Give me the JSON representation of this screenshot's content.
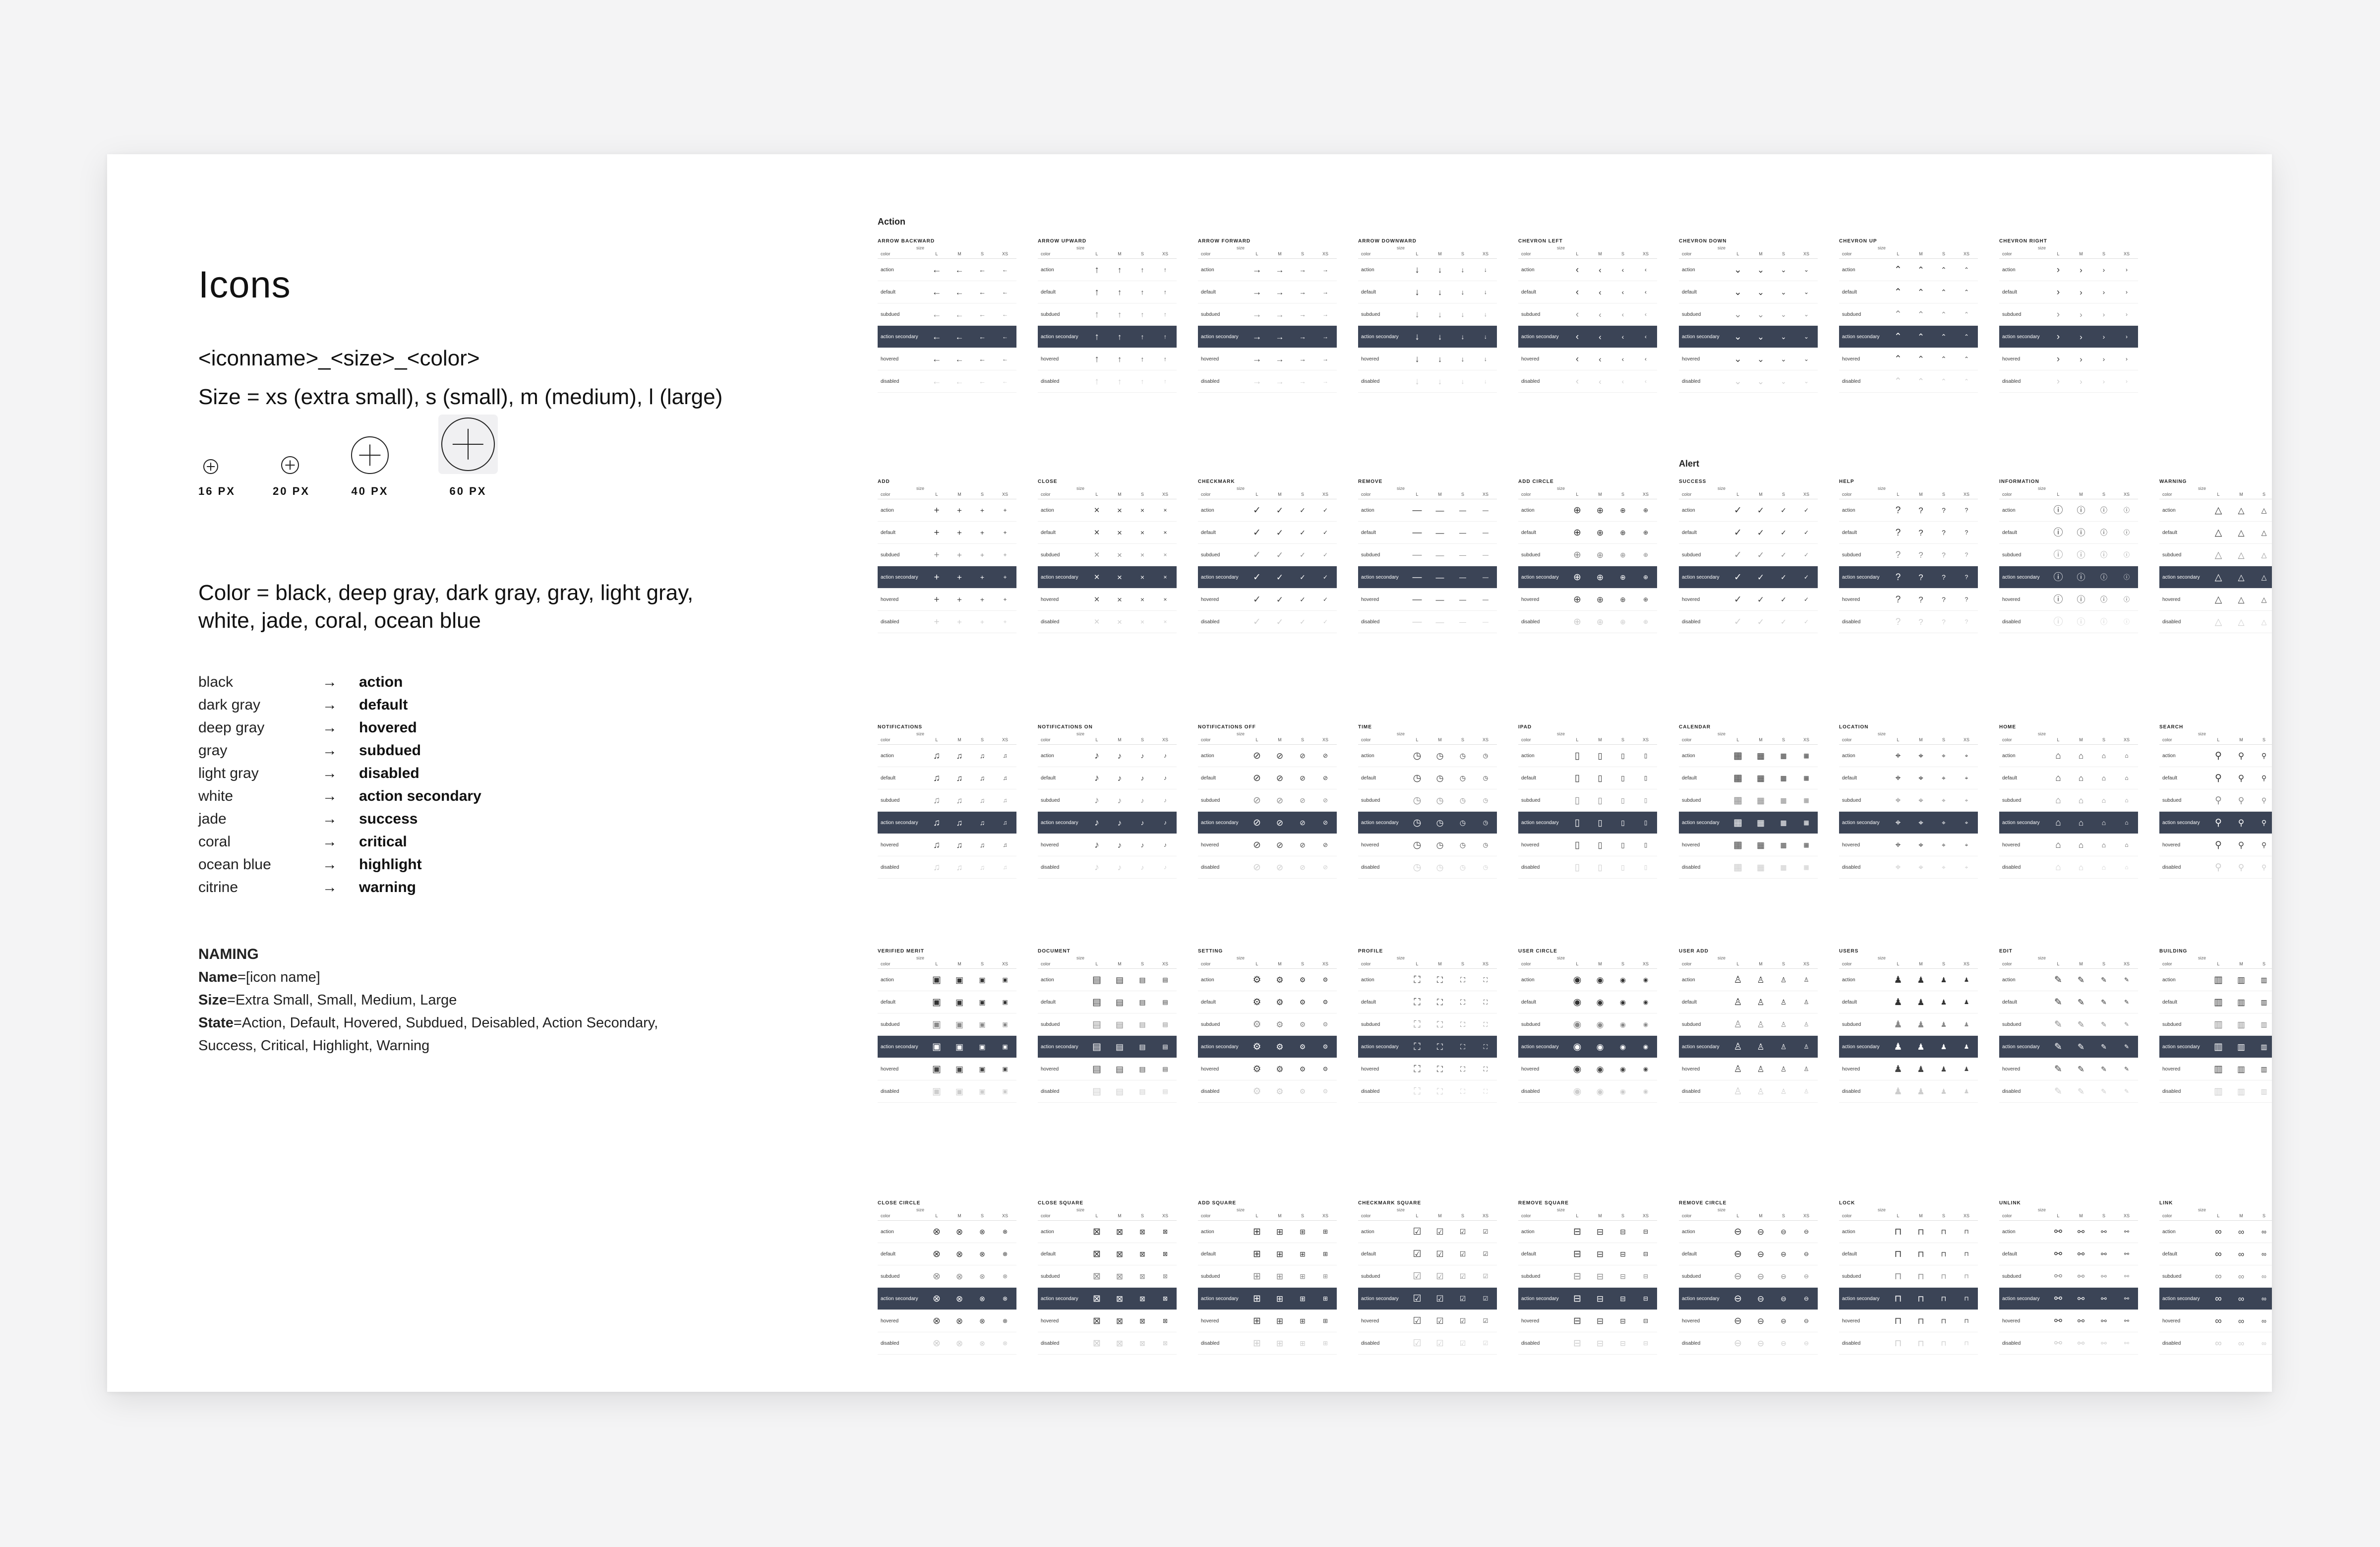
{
  "title": "Icons",
  "format_line": "<iconname>_<size>_<color>",
  "size_line": "Size = xs (extra small), s (small), m (medium), l (large)",
  "size_demos": [
    {
      "label": "16 PX",
      "icon": "add-circle-icon"
    },
    {
      "label": "20 PX",
      "icon": "add-circle-icon"
    },
    {
      "label": "40 PX",
      "icon": "add-circle-icon"
    },
    {
      "label": "60 PX",
      "icon": "add-circle-icon"
    }
  ],
  "color_line_1": "Color = black, deep gray, dark gray, gray, light gray,",
  "color_line_2": "white, jade, coral, ocean blue",
  "arrow": "→",
  "color_map": [
    {
      "color": "black",
      "state": "action"
    },
    {
      "color": "dark gray",
      "state": "default"
    },
    {
      "color": "deep gray",
      "state": "hovered"
    },
    {
      "color": "gray",
      "state": "subdued"
    },
    {
      "color": "light gray",
      "state": "disabled"
    },
    {
      "color": "white",
      "state": "action secondary"
    },
    {
      "color": "jade",
      "state": "success"
    },
    {
      "color": "coral",
      "state": "critical"
    },
    {
      "color": "ocean blue",
      "state": "highlight"
    },
    {
      "color": "citrine",
      "state": "warning"
    }
  ],
  "naming": {
    "heading": "NAMING",
    "name_key": "Name",
    "name_val": "=[icon name]",
    "size_key": "Size",
    "size_val": "=Extra Small, Small, Medium, Large",
    "state_key": "State",
    "state_val_1": "=Action, Default, Hovered, Subdued, Deisabled, Action Secondary,",
    "state_val_2": "Success, Critical, Highlight, Warning"
  },
  "sheet": {
    "section_action": "Action",
    "section_alert": "Alert",
    "size_label": "size",
    "color_label": "color",
    "size_cols": [
      "L",
      "M",
      "S",
      "XS"
    ],
    "dark_row_color": "#3b4456",
    "states": [
      "action",
      "default",
      "subdued",
      "action secondary",
      "hovered",
      "disabled"
    ],
    "groups": [
      {
        "name": "ARROW BACKWARD",
        "glyph": "←"
      },
      {
        "name": "ARROW UPWARD",
        "glyph": "↑"
      },
      {
        "name": "ARROW FORWARD",
        "glyph": "→"
      },
      {
        "name": "ARROW DOWNWARD",
        "glyph": "↓"
      },
      {
        "name": "CHEVRON LEFT",
        "glyph": "‹"
      },
      {
        "name": "CHEVRON DOWN",
        "glyph": "⌄"
      },
      {
        "name": "CHEVRON UP",
        "glyph": "⌃"
      },
      {
        "name": "CHEVRON RIGHT",
        "glyph": "›"
      },
      {
        "name": "ADD",
        "glyph": "+"
      },
      {
        "name": "CLOSE",
        "glyph": "×"
      },
      {
        "name": "CHECKMARK",
        "glyph": "✓"
      },
      {
        "name": "REMOVE",
        "glyph": "—"
      },
      {
        "name": "ADD CIRCLE",
        "glyph": "⊕"
      },
      {
        "name": "SUCCESS",
        "glyph": "✓"
      },
      {
        "name": "HELP",
        "glyph": "?"
      },
      {
        "name": "INFORMATION",
        "glyph": "ⓘ"
      },
      {
        "name": "WARNING",
        "glyph": "△"
      },
      {
        "name": "NOTIFICATIONS",
        "glyph": "♫"
      },
      {
        "name": "NOTIFICATIONS ON",
        "glyph": "♪"
      },
      {
        "name": "NOTIFICATIONS OFF",
        "glyph": "⊘"
      },
      {
        "name": "TIME",
        "glyph": "◷"
      },
      {
        "name": "IPAD",
        "glyph": "▯"
      },
      {
        "name": "CALENDAR",
        "glyph": "▦"
      },
      {
        "name": "LOCATION",
        "glyph": "⌖"
      },
      {
        "name": "HOME",
        "glyph": "⌂"
      },
      {
        "name": "SEARCH",
        "glyph": "⚲"
      },
      {
        "name": "VERIFIED MERIT",
        "glyph": "▣"
      },
      {
        "name": "DOCUMENT",
        "glyph": "▤"
      },
      {
        "name": "SETTING",
        "glyph": "⚙"
      },
      {
        "name": "PROFILE",
        "glyph": "⛶"
      },
      {
        "name": "USER CIRCLE",
        "glyph": "◉"
      },
      {
        "name": "USER ADD",
        "glyph": "♙"
      },
      {
        "name": "USERS",
        "glyph": "♟"
      },
      {
        "name": "EDIT",
        "glyph": "✎"
      },
      {
        "name": "BUILDING",
        "glyph": "▥"
      },
      {
        "name": "CLOSE CIRCLE",
        "glyph": "⊗"
      },
      {
        "name": "CLOSE SQUARE",
        "glyph": "⊠"
      },
      {
        "name": "ADD SQUARE",
        "glyph": "⊞"
      },
      {
        "name": "CHECKMARK SQUARE",
        "glyph": "☑"
      },
      {
        "name": "REMOVE SQUARE",
        "glyph": "⊟"
      },
      {
        "name": "REMOVE CIRCLE",
        "glyph": "⊖"
      },
      {
        "name": "LOCK",
        "glyph": "⊓"
      },
      {
        "name": "UNLINK",
        "glyph": "⚯"
      },
      {
        "name": "LINK",
        "glyph": "∞"
      }
    ]
  }
}
